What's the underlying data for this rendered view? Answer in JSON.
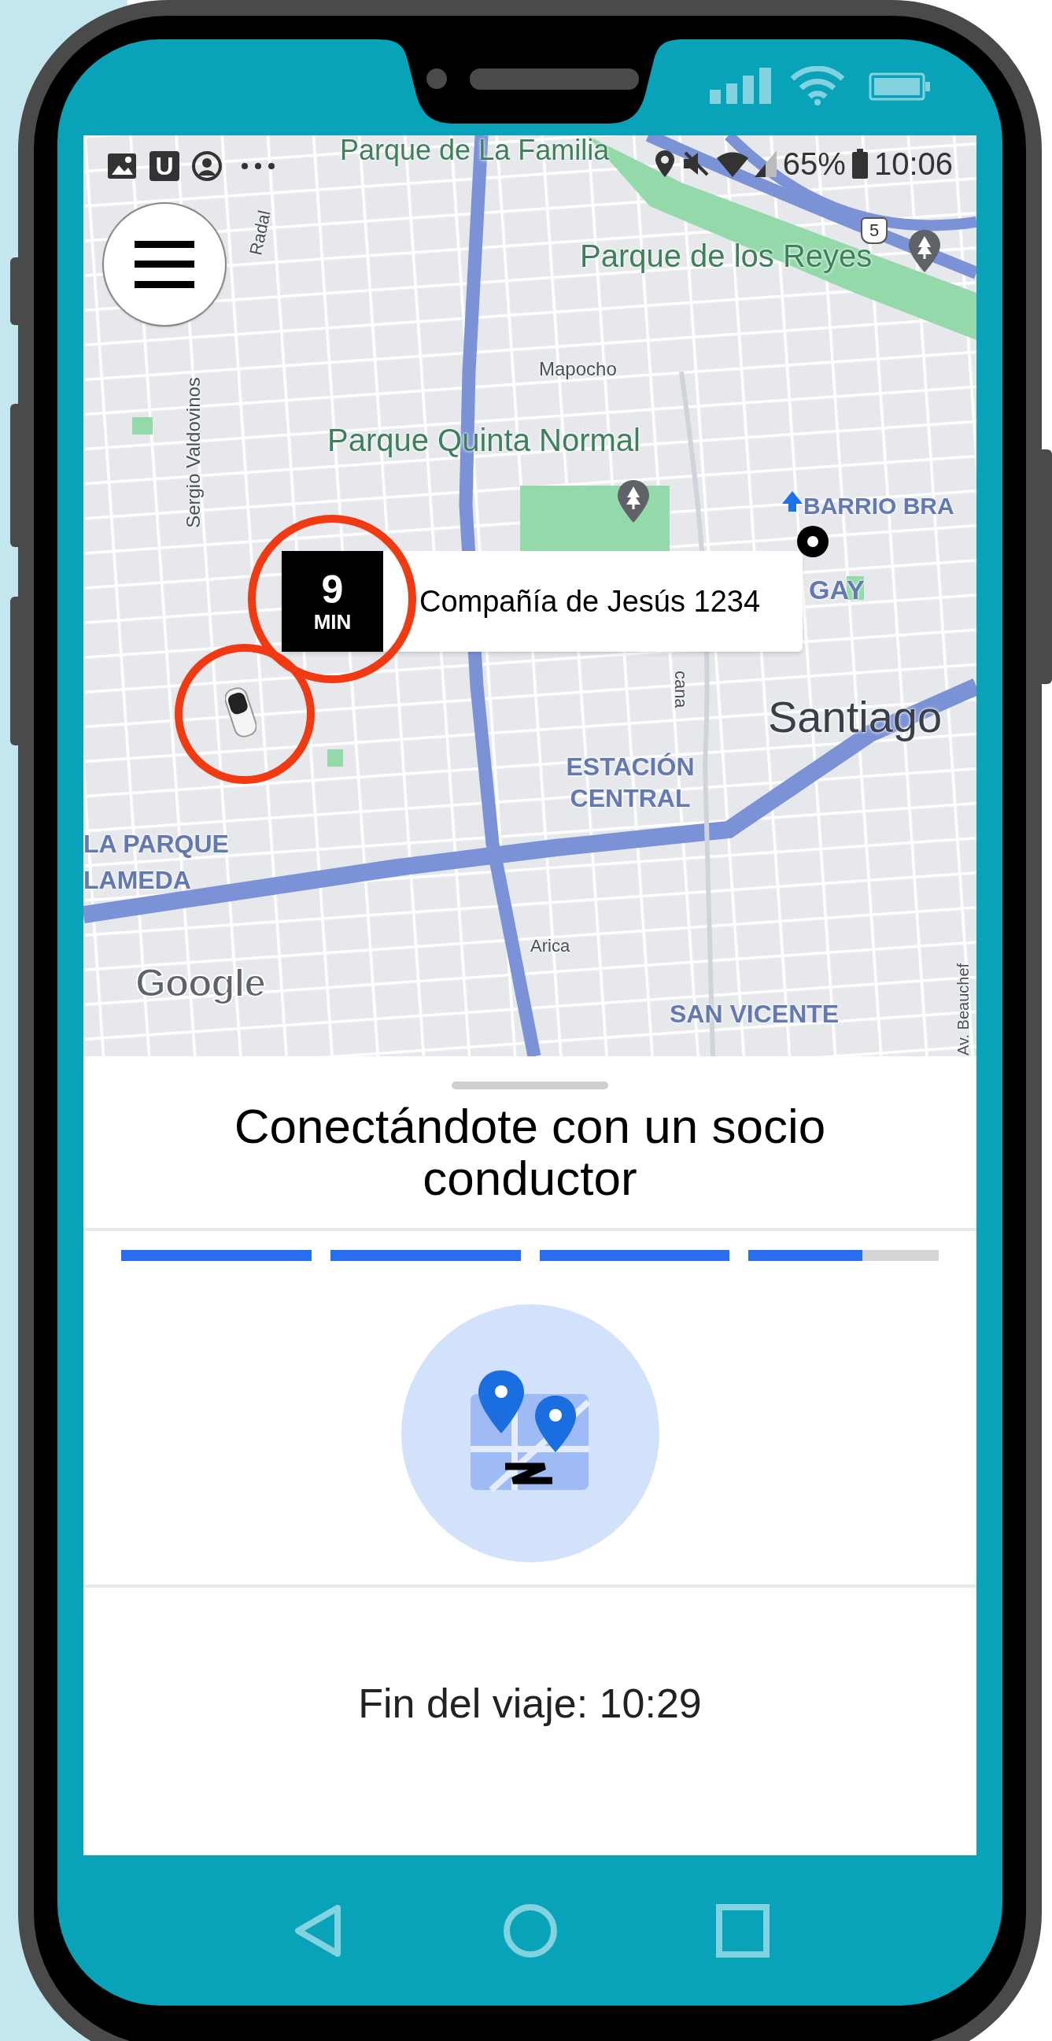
{
  "status_bar": {
    "app_letter": "U",
    "battery": "65%",
    "time": "10:06"
  },
  "map": {
    "labels": [
      {
        "text": "Parque de La Familia",
        "kind": "park"
      },
      {
        "text": "Radal",
        "kind": "street"
      },
      {
        "text": "Parque de los Reyes",
        "kind": "park"
      },
      {
        "text": "Mapocho",
        "kind": "street"
      },
      {
        "text": "Sergio Valdovinos",
        "kind": "street"
      },
      {
        "text": "Parque Quinta Normal",
        "kind": "park"
      },
      {
        "text": "BARRIO BRA",
        "kind": "district"
      },
      {
        "text": "GAY",
        "kind": "district"
      },
      {
        "text": "cana",
        "kind": "street"
      },
      {
        "text": "Santiago",
        "kind": "city"
      },
      {
        "text": "ESTACIÓN CENTRAL",
        "kind": "district"
      },
      {
        "text": "LA PARQUE",
        "kind": "district"
      },
      {
        "text": "LAMEDA",
        "kind": "district"
      },
      {
        "text": "Arica",
        "kind": "street"
      },
      {
        "text": "SAN VICENTE",
        "kind": "district"
      },
      {
        "text": "Av. Beauchef",
        "kind": "street"
      }
    ],
    "route_shield": "5",
    "attribution": "Google"
  },
  "eta_marker": {
    "minutes": "9",
    "unit": "MIN",
    "address": "Compañía de Jesús 1234"
  },
  "sheet": {
    "title": "Conectándote con un socio conductor",
    "progress": [
      {
        "level": 1
      },
      {
        "level": 1
      },
      {
        "level": 1
      },
      {
        "level": 0.6
      }
    ],
    "trip_end": "Fin del viaje: 10:29"
  }
}
